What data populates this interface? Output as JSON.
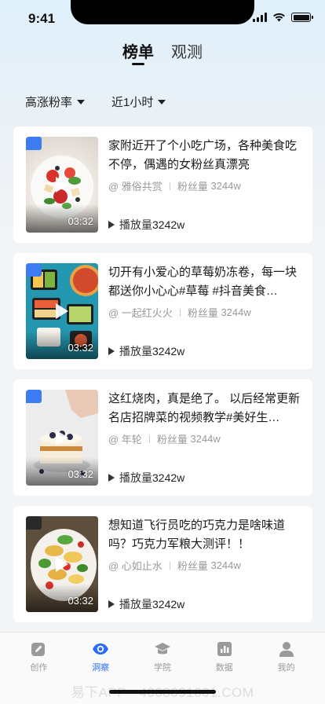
{
  "status": {
    "time": "9:41"
  },
  "tabs": [
    {
      "label": "榜单",
      "active": true
    },
    {
      "label": "观测",
      "active": false
    }
  ],
  "filters": [
    {
      "label": "高涨粉率"
    },
    {
      "label": "近1小时"
    }
  ],
  "meta_labels": {
    "fans": "粉丝量",
    "plays": "播放量"
  },
  "videos": [
    {
      "title": "家附近开了个小吃广场，各种美食吃不停，偶遇的女粉丝真漂亮",
      "author": "@ 雅俗共赏",
      "fans": "3244w",
      "plays": "3242w",
      "duration": "03:32",
      "rank_color": "#3d7bf2",
      "thumb": "salad-plate"
    },
    {
      "title": "切开有小爱心的草莓奶冻卷，每一块都送你小心心#草莓 #抖音美食…",
      "author": "@ 一起红火火",
      "fans": "3244w",
      "plays": "3242w",
      "duration": "03:32",
      "rank_color": "#3d7bf2",
      "thumb": "food-boxes"
    },
    {
      "title": "这红烧肉，真是绝了。 以后经常更新名店招牌菜的视频教学#美好生…",
      "author": "@ 年轮",
      "fans": "3244w",
      "plays": "3242w",
      "duration": "03:32",
      "rank_color": "#3d7bf2",
      "thumb": "cake"
    },
    {
      "title": "想知道飞行员吃的巧克力是啥味道吗？巧克力军粮大测评！！",
      "author": "@ 心如止水",
      "fans": "3244w",
      "plays": "3242w",
      "duration": "03:32",
      "rank_color": "#2a2a2a",
      "thumb": "pasta-salad"
    }
  ],
  "nav": [
    {
      "label": "创作",
      "icon": "edit-icon",
      "active": false
    },
    {
      "label": "洞察",
      "icon": "eye-icon",
      "active": true
    },
    {
      "label": "学院",
      "icon": "graduation-cap-icon",
      "active": false
    },
    {
      "label": "数据",
      "icon": "bar-chart-icon",
      "active": false
    },
    {
      "label": "我的",
      "icon": "user-icon",
      "active": false
    }
  ],
  "watermark": "易下APP · 4008691601.COM",
  "colors": {
    "accent": "#2d6cf6",
    "inactive_nav": "#999999"
  }
}
